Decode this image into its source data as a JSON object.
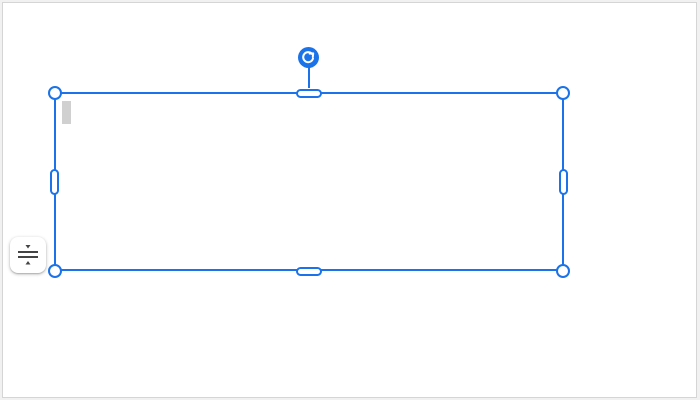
{
  "canvas": {
    "background": "#ffffff",
    "border_color": "#d5d5d5"
  },
  "selection": {
    "accent_color": "#1a73e8",
    "text_content": ""
  },
  "icons": {
    "rotate": "rotate-icon",
    "vertical_align": "vertical-align-middle-icon"
  }
}
